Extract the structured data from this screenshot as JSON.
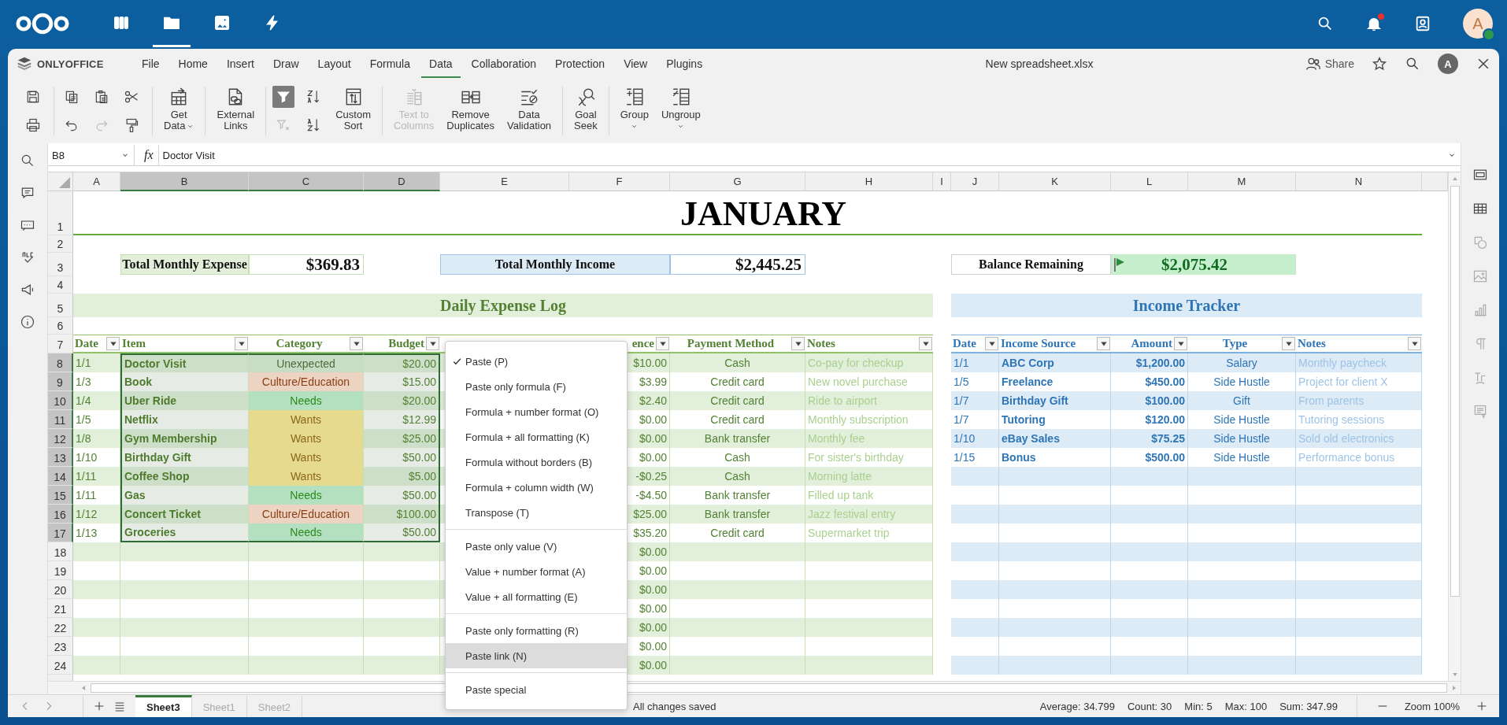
{
  "top_bar": {
    "apps": [
      {
        "kind": "dashboard",
        "selected": false
      },
      {
        "kind": "files",
        "selected": true
      },
      {
        "kind": "photos",
        "selected": false
      },
      {
        "kind": "activity",
        "selected": false
      }
    ],
    "notification_dot": true,
    "avatar": "A"
  },
  "app_name": "ONLYOFFICE",
  "menu_tabs": [
    {
      "label": "File",
      "selected": false
    },
    {
      "label": "Home",
      "selected": false
    },
    {
      "label": "Insert",
      "selected": false
    },
    {
      "label": "Draw",
      "selected": false
    },
    {
      "label": "Layout",
      "selected": false
    },
    {
      "label": "Formula",
      "selected": false
    },
    {
      "label": "Data",
      "selected": true
    },
    {
      "label": "Collaboration",
      "selected": false
    },
    {
      "label": "Protection",
      "selected": false
    },
    {
      "label": "View",
      "selected": false
    },
    {
      "label": "Plugins",
      "selected": false
    }
  ],
  "doc_title": "New spreadsheet.xlsx",
  "share": "Share",
  "user_avatar": "A",
  "toolbar": [
    {
      "small": [
        {
          "kind": "save",
          "disabled": false,
          "active": false
        },
        {
          "kind": "print",
          "disabled": false,
          "active": false
        }
      ]
    },
    {
      "small": [
        {
          "kind": "copy",
          "disabled": false,
          "active": false
        },
        {
          "kind": "undo",
          "disabled": false,
          "active": false
        },
        {
          "kind": "paste",
          "disabled": false,
          "active": false
        },
        {
          "kind": "redo",
          "disabled": true,
          "active": false
        },
        {
          "kind": "cut",
          "disabled": false,
          "active": false
        },
        {
          "kind": "painter",
          "disabled": false,
          "active": false
        }
      ]
    },
    {
      "large": [
        {
          "kind": "get-data",
          "lines": [
            "Get",
            "Data"
          ],
          "caret": true,
          "disabled": false
        }
      ]
    },
    {
      "large": [
        {
          "kind": "external-links",
          "lines": [
            "External",
            "Links"
          ],
          "caret": false,
          "disabled": false
        }
      ]
    },
    {
      "small": [
        {
          "kind": "filter",
          "disabled": false,
          "active": true
        },
        {
          "kind": "clear-filter",
          "disabled": true,
          "active": false
        },
        {
          "kind": "sort-az",
          "disabled": false,
          "active": false
        },
        {
          "kind": "sort-za",
          "disabled": false,
          "active": false
        }
      ],
      "large": [
        {
          "kind": "custom-sort",
          "lines": [
            "Custom",
            "Sort"
          ],
          "caret": false,
          "disabled": false
        }
      ]
    },
    {
      "large": [
        {
          "kind": "text-to-columns",
          "lines": [
            "Text to",
            "Columns"
          ],
          "caret": false,
          "disabled": true
        },
        {
          "kind": "remove-duplicates",
          "lines": [
            "Remove",
            "Duplicates"
          ],
          "caret": false,
          "disabled": false
        },
        {
          "kind": "data-validation",
          "lines": [
            "Data",
            "Validation"
          ],
          "caret": false,
          "disabled": false
        }
      ]
    },
    {
      "large": [
        {
          "kind": "goal-seek",
          "lines": [
            "Goal",
            "Seek"
          ],
          "caret": false,
          "disabled": false
        }
      ]
    },
    {
      "large": [
        {
          "kind": "group",
          "lines": [
            "Group"
          ],
          "caret": true,
          "disabled": false
        },
        {
          "kind": "ungroup",
          "lines": [
            "Ungroup"
          ],
          "caret": true,
          "disabled": false
        }
      ]
    }
  ],
  "name_box": "B8",
  "fx": "fx",
  "formula": "Doctor Visit",
  "columns": [
    {
      "label": "A",
      "selected": false
    },
    {
      "label": "B",
      "selected": true
    },
    {
      "label": "C",
      "selected": true
    },
    {
      "label": "D",
      "selected": true
    },
    {
      "label": "E",
      "selected": false
    },
    {
      "label": "F",
      "selected": false
    },
    {
      "label": "G",
      "selected": false
    },
    {
      "label": "H",
      "selected": false
    },
    {
      "label": "I",
      "selected": false
    },
    {
      "label": "J",
      "selected": false
    },
    {
      "label": "K",
      "selected": false
    },
    {
      "label": "L",
      "selected": false
    },
    {
      "label": "M",
      "selected": false
    },
    {
      "label": "N",
      "selected": false
    }
  ],
  "rows": [
    {
      "label": "1",
      "selected": false
    },
    {
      "label": "2",
      "selected": false
    },
    {
      "label": "3",
      "selected": false
    },
    {
      "label": "4",
      "selected": false
    },
    {
      "label": "5",
      "selected": false
    },
    {
      "label": "6",
      "selected": false
    },
    {
      "label": "7",
      "selected": false
    },
    {
      "label": "8",
      "selected": true
    },
    {
      "label": "9",
      "selected": true
    },
    {
      "label": "10",
      "selected": true
    },
    {
      "label": "11",
      "selected": true
    },
    {
      "label": "12",
      "selected": true
    },
    {
      "label": "13",
      "selected": true
    },
    {
      "label": "14",
      "selected": true
    },
    {
      "label": "15",
      "selected": true
    },
    {
      "label": "16",
      "selected": true
    },
    {
      "label": "17",
      "selected": true
    },
    {
      "label": "18",
      "selected": false
    },
    {
      "label": "19",
      "selected": false
    },
    {
      "label": "20",
      "selected": false
    },
    {
      "label": "21",
      "selected": false
    },
    {
      "label": "22",
      "selected": false
    },
    {
      "label": "23",
      "selected": false
    },
    {
      "label": "24",
      "selected": false
    }
  ],
  "title": "JANUARY",
  "summary": {
    "expense_label": "Total Monthly Expense",
    "expense_value": "$369.83",
    "income_label": "Total Monthly Income",
    "income_value": "$2,445.25",
    "balance_label": "Balance Remaining",
    "balance_value": "$2,075.42"
  },
  "expense_log": {
    "title": "Daily Expense Log",
    "headers": [
      "Date",
      "Item",
      "Category",
      "Budget",
      "ence",
      "Payment Method",
      "Notes"
    ],
    "rows": [
      {
        "date": "1/1",
        "item": "Doctor Visit",
        "category": "Unexpected",
        "color": "#c9dcc6",
        "budget": "$20.00",
        "difference": "$10.00",
        "payment": "Cash",
        "notes": "Co-pay for checkup"
      },
      {
        "date": "1/3",
        "item": "Book",
        "category": "Culture/Education",
        "color": "#ecd3c2",
        "budget": "$15.00",
        "difference": "$3.99",
        "payment": "Credit card",
        "notes": "New novel purchase"
      },
      {
        "date": "1/4",
        "item": "Uber Ride",
        "category": "Needs",
        "color": "#b4e0c2",
        "budget": "$20.00",
        "difference": "$2.40",
        "payment": "Credit card",
        "notes": "Ride to airport"
      },
      {
        "date": "1/5",
        "item": "Netflix",
        "category": "Wants",
        "color": "#e6da8e",
        "budget": "$12.99",
        "difference": "$0.00",
        "payment": "Credit card",
        "notes": "Monthly subscription"
      },
      {
        "date": "1/8",
        "item": "Gym Membership",
        "category": "Wants",
        "color": "#e6da8e",
        "budget": "$25.00",
        "difference": "$0.00",
        "payment": "Bank transfer",
        "notes": "Monthly fee"
      },
      {
        "date": "1/10",
        "item": "Birthday Gift",
        "category": "Wants",
        "color": "#e6da8e",
        "budget": "$50.00",
        "difference": "$0.00",
        "payment": "Cash",
        "notes": "For sister's birthday"
      },
      {
        "date": "1/11",
        "item": "Coffee Shop",
        "category": "Wants",
        "color": "#e6da8e",
        "budget": "$5.00",
        "difference": "-$0.25",
        "payment": "Cash",
        "notes": "Morning latte"
      },
      {
        "date": "1/11",
        "item": "Gas",
        "category": "Needs",
        "color": "#b4e0c2",
        "budget": "$50.00",
        "difference": "-$4.50",
        "payment": "Bank transfer",
        "notes": "Filled up tank"
      },
      {
        "date": "1/12",
        "item": "Concert Ticket",
        "category": "Culture/Education",
        "color": "#ecd3c2",
        "budget": "$100.00",
        "difference": "$25.00",
        "payment": "Bank transfer",
        "notes": "Jazz festival entry"
      },
      {
        "date": "1/13",
        "item": "Groceries",
        "category": "Needs",
        "color": "#b4e0c2",
        "budget": "$50.00",
        "difference": "$35.20",
        "payment": "Credit card",
        "notes": "Supermarket trip"
      },
      {
        "difference": "$0.00"
      },
      {
        "difference": "$0.00"
      },
      {
        "difference": "$0.00"
      },
      {
        "difference": "$0.00"
      },
      {
        "difference": "$0.00"
      },
      {
        "difference": "$0.00"
      },
      {
        "difference": "$0.00"
      }
    ]
  },
  "income_tracker": {
    "title": "Income Tracker",
    "headers": [
      "Date",
      "Income Source",
      "Amount",
      "Type",
      "Notes"
    ],
    "rows": [
      {
        "date": "1/1",
        "source": "ABC Corp",
        "amount": "$1,200.00",
        "type": "Salary",
        "notes": "Monthly paycheck"
      },
      {
        "date": "1/5",
        "source": "Freelance",
        "amount": "$450.00",
        "type": "Side Hustle",
        "notes": "Project for client X"
      },
      {
        "date": "1/7",
        "source": "Birthday Gift",
        "amount": "$100.00",
        "type": "Gift",
        "notes": "From parents"
      },
      {
        "date": "1/7",
        "source": "Tutoring",
        "amount": "$120.00",
        "type": "Side Hustle",
        "notes": "Tutoring sessions"
      },
      {
        "date": "1/10",
        "source": "eBay Sales",
        "amount": "$75.25",
        "type": "Side Hustle",
        "notes": "Sold old electronics"
      },
      {
        "date": "1/15",
        "source": "Bonus",
        "amount": "$500.00",
        "type": "Side Hustle",
        "notes": "Performance bonus"
      }
    ]
  },
  "context_menu": [
    [
      {
        "label": "Paste (P)",
        "checked": true,
        "highlighted": false
      },
      {
        "label": "Paste only formula (F)",
        "checked": false,
        "highlighted": false
      },
      {
        "label": "Formula + number format (O)",
        "checked": false,
        "highlighted": false
      },
      {
        "label": "Formula + all formatting (K)",
        "checked": false,
        "highlighted": false
      },
      {
        "label": "Formula without borders (B)",
        "checked": false,
        "highlighted": false
      },
      {
        "label": "Formula + column width (W)",
        "checked": false,
        "highlighted": false
      },
      {
        "label": "Transpose (T)",
        "checked": false,
        "highlighted": false
      }
    ],
    [
      {
        "label": "Paste only value (V)",
        "checked": false,
        "highlighted": false
      },
      {
        "label": "Value + number format (A)",
        "checked": false,
        "highlighted": false
      },
      {
        "label": "Value + all formatting (E)",
        "checked": false,
        "highlighted": false
      }
    ],
    [
      {
        "label": "Paste only formatting (R)",
        "checked": false,
        "highlighted": false
      },
      {
        "label": "Paste link (N)",
        "checked": false,
        "highlighted": true
      }
    ],
    [
      {
        "label": "Paste special",
        "checked": false,
        "highlighted": false
      }
    ]
  ],
  "sheets": [
    {
      "label": "Sheet3",
      "selected": true
    },
    {
      "label": "Sheet1",
      "selected": false
    },
    {
      "label": "Sheet2",
      "selected": false
    }
  ],
  "save_status": "All changes saved",
  "stats": [
    "Average: 34.799",
    "Count: 30",
    "Min: 5",
    "Max: 100",
    "Sum: 347.99"
  ],
  "zoom": "Zoom 100%"
}
